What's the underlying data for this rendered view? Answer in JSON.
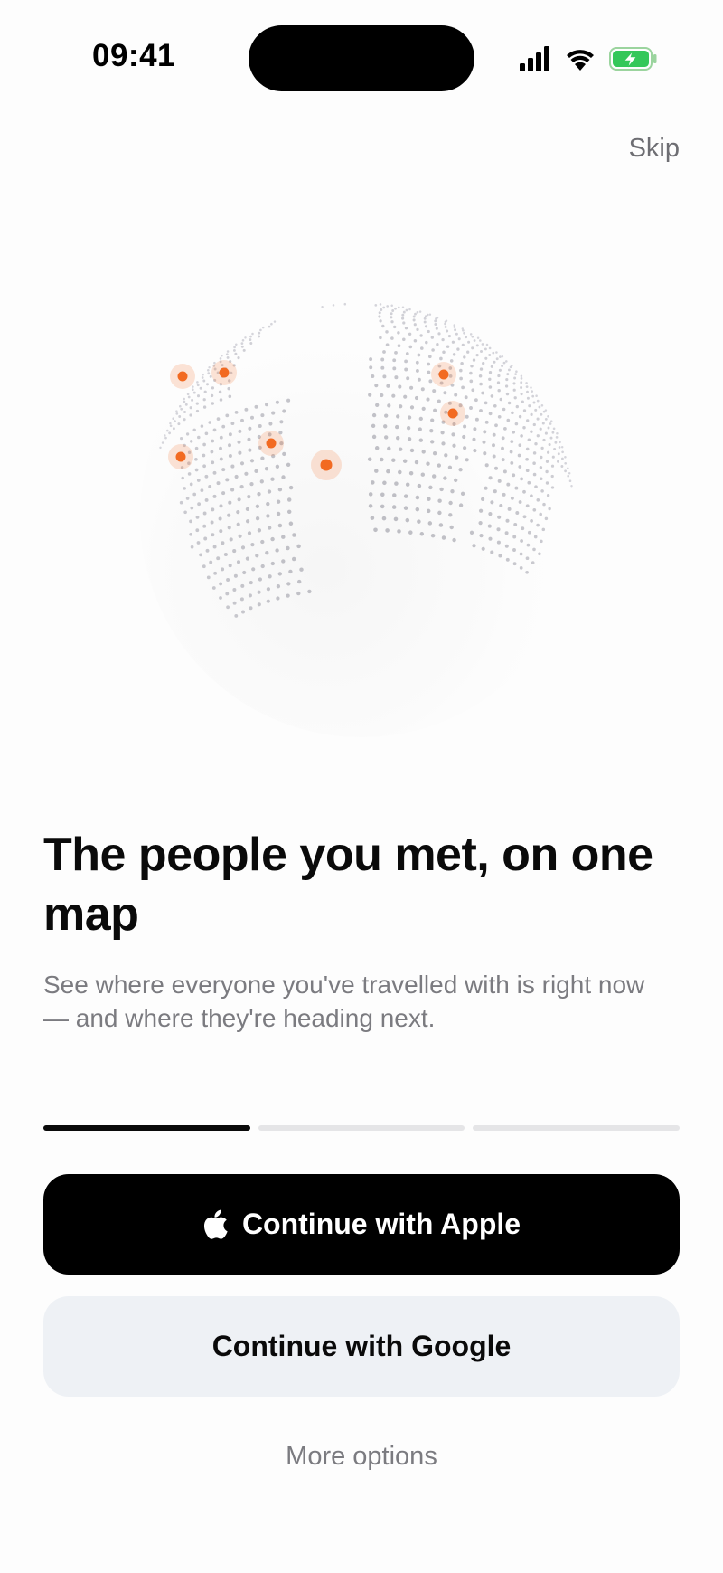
{
  "status_bar": {
    "time": "09:41"
  },
  "header": {
    "skip_label": "Skip"
  },
  "onboarding": {
    "title": "The people you met, on one map",
    "subtitle": "See where everyone you've travelled with is right now — and where they're heading next.",
    "progress": {
      "current_step": 1,
      "total_steps": 3
    }
  },
  "actions": {
    "apple_label": "Continue with Apple",
    "google_label": "Continue with Google",
    "more_options_label": "More options"
  },
  "colors": {
    "accent": "#f26a21",
    "primary_button": "#000000",
    "secondary_button": "#eef1f5",
    "muted_text": "#7b7b80"
  },
  "icons": [
    "signal-icon",
    "wifi-icon",
    "battery-charging-icon",
    "apple-logo-icon",
    "globe-illustration"
  ]
}
